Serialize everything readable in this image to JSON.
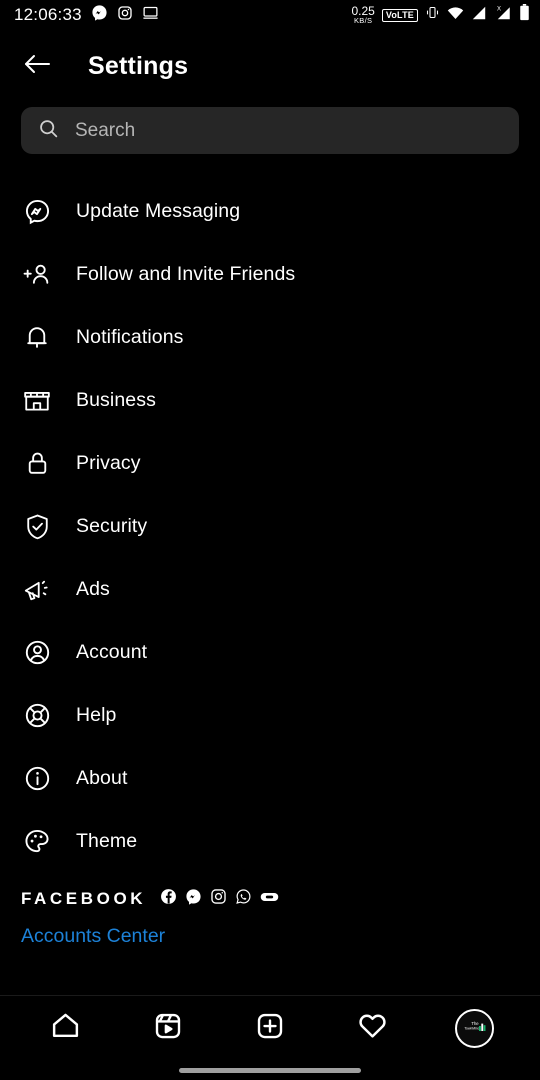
{
  "status_bar": {
    "time": "12:06:33",
    "left_icons": [
      "messenger-icon",
      "instagram-icon",
      "desktop-monitor-icon"
    ],
    "net_speed_value": "0.25",
    "net_speed_unit": "KB/S",
    "volte_label": "VoLTE",
    "right_icons": [
      "vibrate-icon",
      "wifi-icon",
      "signal-icon",
      "signal-x-icon",
      "battery-icon"
    ]
  },
  "header": {
    "back_label": "Back",
    "title": "Settings"
  },
  "search": {
    "placeholder": "Search",
    "value": "",
    "icon": "search-icon"
  },
  "menu": {
    "items": [
      {
        "label": "Update Messaging",
        "icon": "messenger-icon"
      },
      {
        "label": "Follow and Invite Friends",
        "icon": "add-person-icon"
      },
      {
        "label": "Notifications",
        "icon": "bell-icon"
      },
      {
        "label": "Business",
        "icon": "storefront-icon"
      },
      {
        "label": "Privacy",
        "icon": "lock-icon"
      },
      {
        "label": "Security",
        "icon": "shield-check-icon"
      },
      {
        "label": "Ads",
        "icon": "megaphone-icon"
      },
      {
        "label": "Account",
        "icon": "person-circle-icon"
      },
      {
        "label": "Help",
        "icon": "life-ring-icon"
      },
      {
        "label": "About",
        "icon": "info-circle-icon"
      },
      {
        "label": "Theme",
        "icon": "palette-icon"
      }
    ]
  },
  "facebook_section": {
    "word": "FACEBOOK",
    "brand_icons": [
      "facebook-icon",
      "messenger-icon",
      "instagram-icon",
      "whatsapp-icon",
      "portal-icon"
    ],
    "accounts_center_label": "Accounts Center"
  },
  "bottom_nav": {
    "items": [
      {
        "name": "home",
        "icon": "home-icon"
      },
      {
        "name": "reels",
        "icon": "reels-icon"
      },
      {
        "name": "create",
        "icon": "plus-square-icon"
      },
      {
        "name": "activity",
        "icon": "heart-icon"
      },
      {
        "name": "profile",
        "icon": "avatar-icon"
      }
    ]
  },
  "colors": {
    "background": "#000000",
    "search_field": "#262626",
    "link_blue": "#1d82d8",
    "text_primary": "#ffffff",
    "placeholder": "#b5b5b5",
    "home_indicator": "#a0a0a0"
  }
}
